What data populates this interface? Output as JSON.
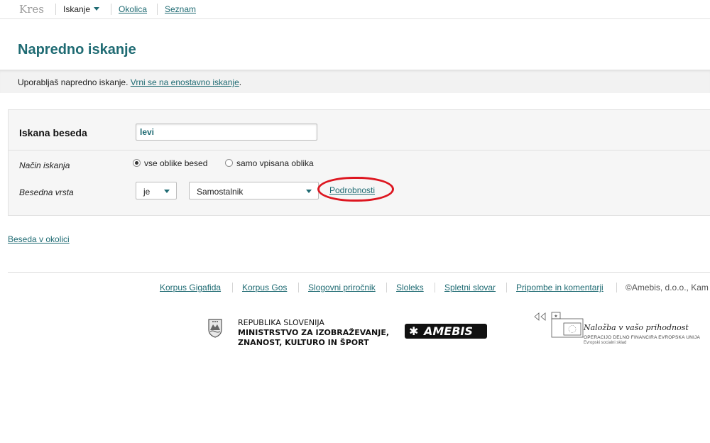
{
  "nav": {
    "brand": "Kres",
    "items": [
      {
        "label": "Iskanje",
        "current": true
      },
      {
        "label": "Okolica",
        "current": false
      },
      {
        "label": "Seznam",
        "current": false
      }
    ]
  },
  "page": {
    "title": "Napredno iskanje",
    "mode_text": "Uporabljaš napredno iskanje. ",
    "mode_link": "Vrni se na enostavno iskanje",
    "mode_suffix": "."
  },
  "form": {
    "word_label": "Iskana beseda",
    "word_value": "levi",
    "mode_label": "Način iskanja",
    "radio_all": "vse oblike besed",
    "radio_exact": "samo vpisana oblika",
    "radio_selected": "all",
    "pos_label": "Besedna vrsta",
    "pos_operator": "je",
    "pos_value": "Samostalnik",
    "details_link": "Podrobnosti"
  },
  "near_link": "Beseda v okolici",
  "footer": {
    "links": [
      "Korpus Gigafida",
      "Korpus Gos",
      "Slogovni priročnik",
      "Sloleks",
      "Spletni slovar",
      "Pripombe in komentarji"
    ],
    "copyright": "©Amebis, d.o.o., Kam"
  },
  "logos": {
    "ministry_line1": "REPUBLIKA SLOVENIJA",
    "ministry_line2": "MINISTRSTVO ZA IZOBRAŽEVANJE,",
    "ministry_line3": "ZNANOST, KULTURO IN ŠPORT",
    "amebis": "AMEBIS",
    "eu_main": "Naložba v vašo prihodnost",
    "eu_sub": "OPERACIJO DELNO FINANCIRA EVROPSKA UNIJA",
    "eu_sub2": "Evropski socialni sklad"
  },
  "colors": {
    "accent": "#1f6b73",
    "highlight_ring": "#dd1620"
  }
}
